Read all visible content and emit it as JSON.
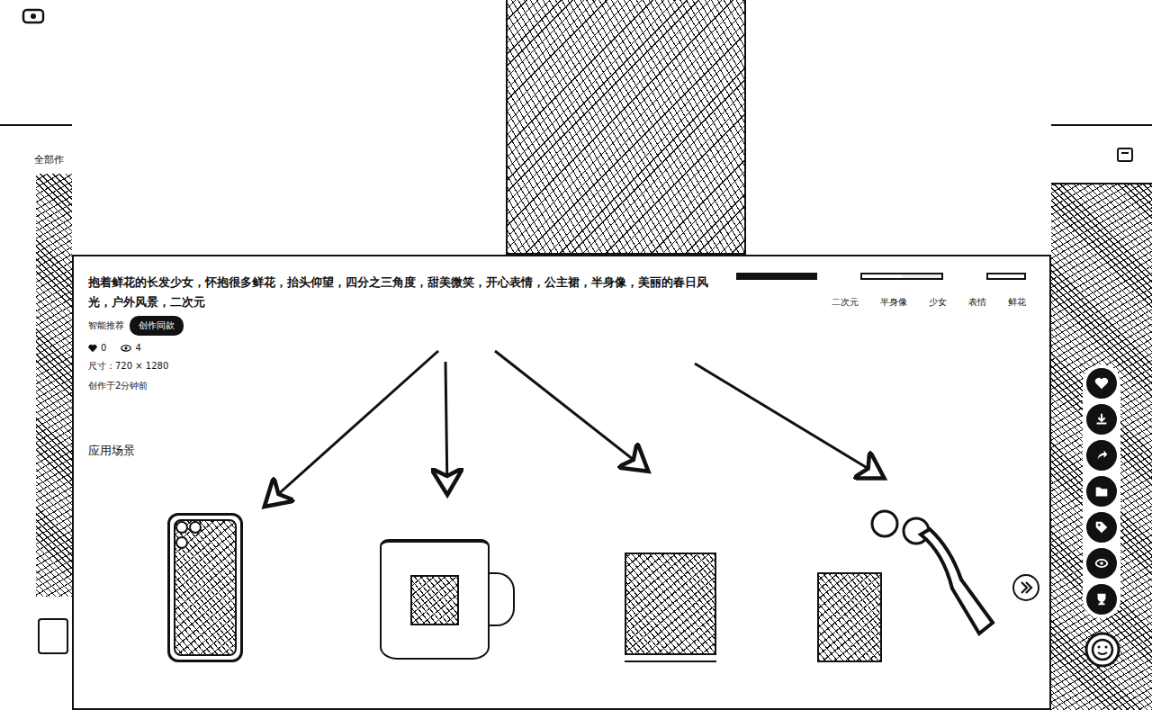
{
  "page": {
    "left_label": "全部作"
  },
  "detail": {
    "prompt": "抱着鲜花的长发少女，怀抱很多鲜花，抬头仰望，四分之三角度，甜美微笑，开心表情，公主裙，半身像，美丽的春日风光，户外风景，二次元",
    "recommend_label": "智能推荐",
    "create_button": "创作同款",
    "likes": "0",
    "views": "4",
    "size": "尺寸：720 × 1280",
    "created": "创作于2分钟前",
    "tags": [
      "二次元",
      "半身像",
      "少女",
      "表情",
      "鲜花"
    ],
    "section_title": "应用场景",
    "scenes": [
      {
        "kind": "phone"
      },
      {
        "kind": "mug"
      },
      {
        "kind": "frame"
      },
      {
        "kind": "keychain"
      }
    ]
  },
  "toolbar": [
    {
      "kind": "like"
    },
    {
      "kind": "download"
    },
    {
      "kind": "share"
    },
    {
      "kind": "folder"
    },
    {
      "kind": "tag"
    },
    {
      "kind": "eye"
    },
    {
      "kind": "trophy"
    }
  ]
}
